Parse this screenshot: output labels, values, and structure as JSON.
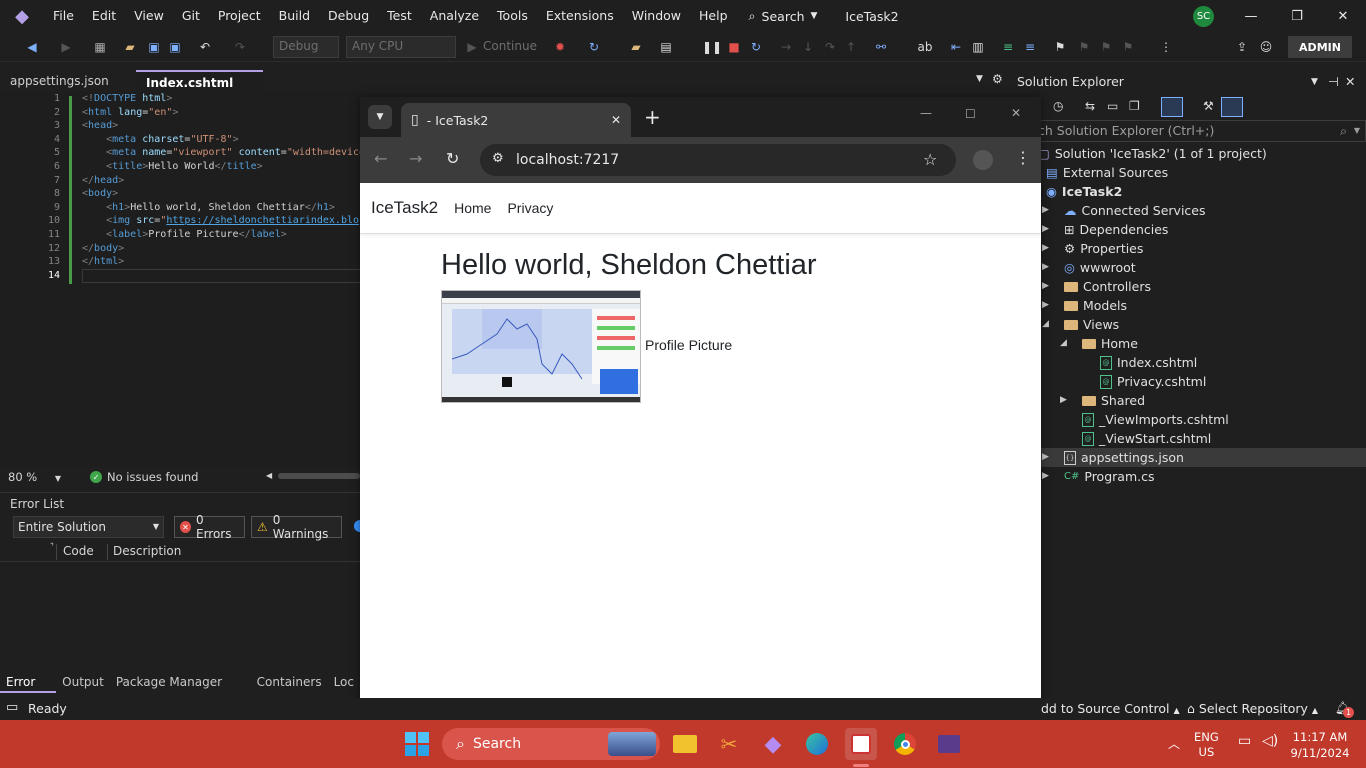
{
  "menubar": {
    "items": [
      "File",
      "Edit",
      "View",
      "Git",
      "Project",
      "Build",
      "Debug",
      "Test",
      "Analyze",
      "Tools",
      "Extensions",
      "Window",
      "Help"
    ],
    "search_label": "Search",
    "solution_name": "IceTask2",
    "avatar_initials": "SC"
  },
  "toolbar": {
    "config": "Debug",
    "platform": "Any CPU",
    "continue_label": "Continue",
    "admin_label": "ADMIN"
  },
  "doc_tabs": {
    "tab1": "appsettings.json",
    "tab2": "Index.cshtml"
  },
  "editor": {
    "line_numbers": [
      "1",
      "2",
      "3",
      "4",
      "5",
      "6",
      "7",
      "8",
      "9",
      "10",
      "11",
      "12",
      "13",
      "14"
    ],
    "zoom": "80 %",
    "status": "No issues found"
  },
  "error_list": {
    "title": "Error List",
    "scope": "Entire Solution",
    "errors": "0 Errors",
    "warnings": "0 Warnings",
    "col_code": "Code",
    "col_description": "Description",
    "tabs": [
      "Error List",
      "Output",
      "Package Manager Console",
      "Containers",
      "Loc"
    ]
  },
  "browser": {
    "tab_title": "- IceTask2",
    "url": "localhost:7217",
    "brand": "IceTask2",
    "nav_home": "Home",
    "nav_privacy": "Privacy",
    "heading": "Hello world, Sheldon Chettiar",
    "image_label": "Profile Picture"
  },
  "solution_explorer": {
    "title": "Solution Explorer",
    "search_placeholder": "ch Solution Explorer (Ctrl+;)",
    "solution_line": "Solution 'IceTask2' (1 of 1 project)",
    "external": "External Sources",
    "project": "IceTask2",
    "items": {
      "connected": "Connected Services",
      "dependencies": "Dependencies",
      "properties": "Properties",
      "wwwroot": "wwwroot",
      "controllers": "Controllers",
      "models": "Models",
      "views": "Views",
      "home": "Home",
      "index": "Index.cshtml",
      "privacy": "Privacy.cshtml",
      "shared": "Shared",
      "viewimports": "_ViewImports.cshtml",
      "viewstart": "_ViewStart.cshtml",
      "appsettings": "appsettings.json",
      "program": "Program.cs"
    }
  },
  "statusbar": {
    "ready": "Ready",
    "source_control": "dd to Source Control",
    "select_repo": "Select Repository",
    "notifications": "1"
  },
  "taskbar": {
    "search_label": "Search",
    "lang_top": "ENG",
    "lang_bottom": "US",
    "time": "11:17 AM",
    "date": "9/11/2024"
  }
}
